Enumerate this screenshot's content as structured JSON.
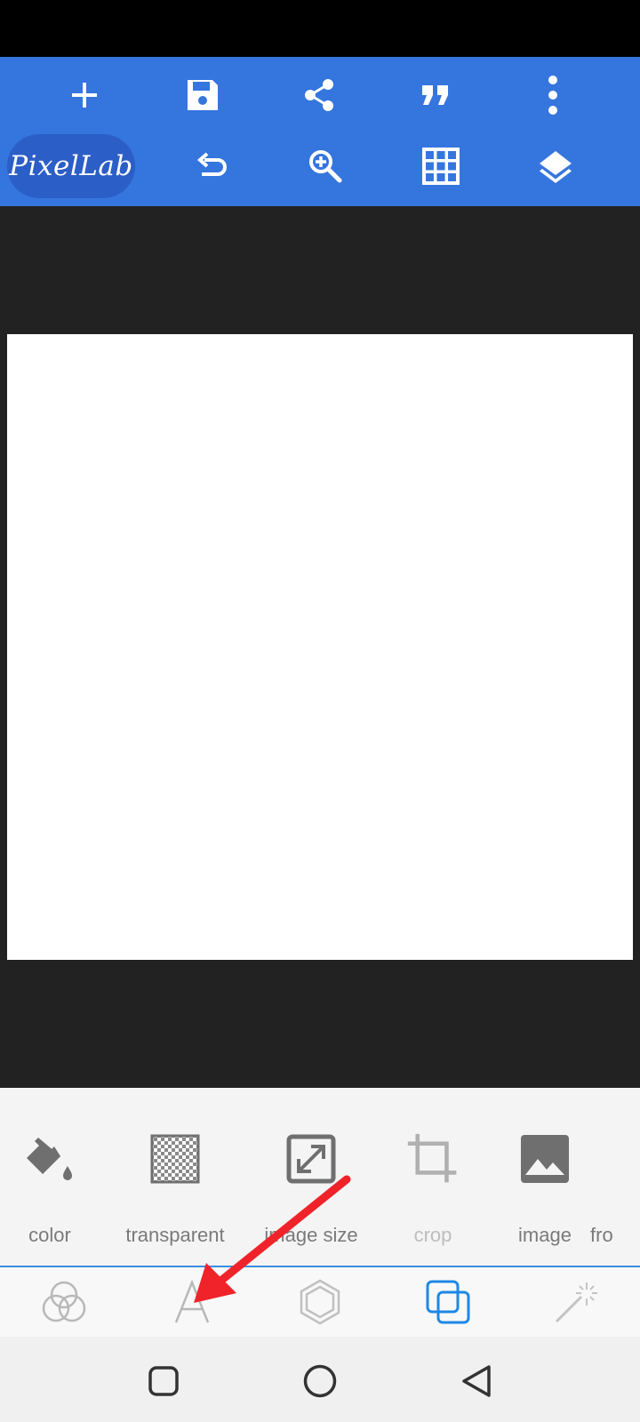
{
  "app": {
    "logo_text": "PixelLab"
  },
  "toolbar": {
    "row1": [
      "add-icon",
      "save-icon",
      "share-icon",
      "quote-icon",
      "more-vert-icon"
    ],
    "row2": [
      "undo-icon",
      "zoom-in-icon",
      "grid-icon",
      "layers-icon"
    ]
  },
  "tools": {
    "items": [
      {
        "label": "color",
        "icon": "paint-bucket-icon"
      },
      {
        "label": "transparent",
        "icon": "transparent-grid-icon"
      },
      {
        "label": "image size",
        "icon": "resize-icon"
      },
      {
        "label": "crop",
        "icon": "crop-icon",
        "disabled": true
      },
      {
        "label": "image",
        "icon": "image-icon"
      },
      {
        "label": "fro",
        "icon": ""
      }
    ]
  },
  "tabs": {
    "items": [
      "blend-icon",
      "text-icon",
      "shape-icon",
      "layers-tab-icon",
      "effects-wand-icon"
    ],
    "active_index": 3
  },
  "colors": {
    "toolbar": "#3575de",
    "workspace": "#222222",
    "accent": "#1e88e5",
    "annotation": "#f0232a"
  }
}
